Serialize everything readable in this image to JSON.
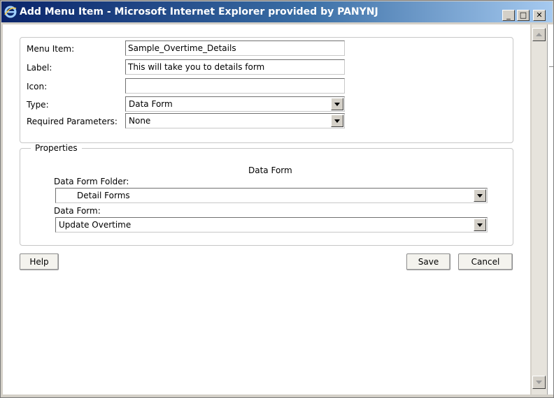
{
  "window": {
    "title": "Add Menu Item - Microsoft Internet Explorer provided by PANYNJ",
    "min_glyph": "_",
    "max_glyph": "□",
    "close_glyph": "✕"
  },
  "form": {
    "menu_item_label": "Menu Item:",
    "menu_item_value": "Sample_Overtime_Details",
    "label_label": "Label:",
    "label_value": "This will take you to details form",
    "icon_label": "Icon:",
    "icon_value": "",
    "type_label": "Type:",
    "type_value": "Data Form",
    "required_params_label": "Required Parameters:",
    "required_params_value": "None"
  },
  "properties": {
    "legend": "Properties",
    "section_title": "Data Form",
    "folder_label": "Data Form Folder:",
    "folder_value": "Detail Forms",
    "data_form_label": "Data Form:",
    "data_form_value": "Update Overtime"
  },
  "buttons": {
    "help": "Help",
    "save": "Save",
    "cancel": "Cancel"
  },
  "icons": {
    "window_icon": "ie-logo-icon",
    "dropdown": "chevron-down-icon",
    "scroll_up": "scroll-up-icon",
    "scroll_down": "scroll-down-icon"
  }
}
